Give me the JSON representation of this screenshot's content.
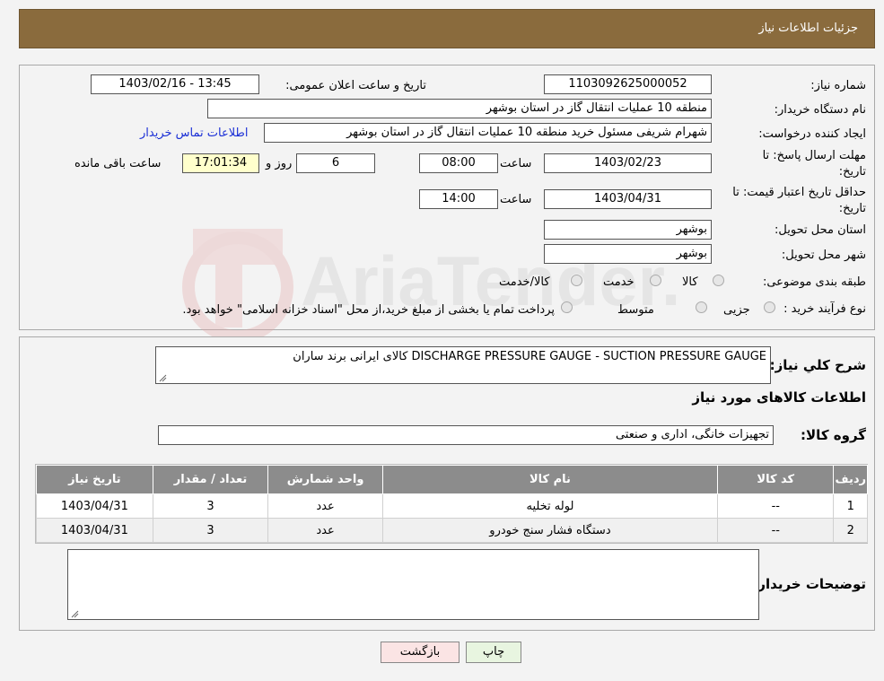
{
  "header": {
    "title": "جزئیات اطلاعات نیاز"
  },
  "form": {
    "need_number_label": "شماره نیاز:",
    "need_number": "1103092625000052",
    "announce_label": "تاریخ و ساعت اعلان عمومی:",
    "announce_value": "1403/02/16 - 13:45",
    "buyer_org_label": "نام دستگاه خریدار:",
    "buyer_org": "منطقه 10 عملیات انتقال گاز در استان بوشهر",
    "creator_label": "ایجاد کننده درخواست:",
    "creator": "شهرام شریفی مسئول خرید منطقه 10 عملیات انتقال گاز در استان بوشهر",
    "contact_link": "اطلاعات تماس خریدار",
    "deadline_label_1": "مهلت ارسال پاسخ: تا",
    "deadline_label_2": "تاریخ:",
    "deadline_date": "1403/02/23",
    "time_label": "ساعت",
    "deadline_time": "08:00",
    "days_value": "6",
    "days_label": "روز و",
    "remaining_time": "17:01:34",
    "remaining_label": "ساعت باقی مانده",
    "validity_label_1": "حداقل تاریخ اعتبار قیمت: تا",
    "validity_label_2": "تاریخ:",
    "validity_date": "1403/04/31",
    "validity_time": "14:00",
    "province_label": "استان محل تحویل:",
    "province": "بوشهر",
    "city_label": "شهر محل تحویل:",
    "city": "بوشهر",
    "category_label": "طبقه بندی موضوعی:",
    "category_options": [
      "کالا",
      "خدمت",
      "کالا/خدمت"
    ],
    "process_label": "نوع فرآیند خرید :",
    "process_options": [
      "جزیی",
      "متوسط"
    ],
    "process_note": "پرداخت تمام یا بخشی از مبلغ خرید،از محل \"اسناد خزانه اسلامی\" خواهد بود."
  },
  "watermark": {
    "text": "AriaTender.neT"
  },
  "details": {
    "summary_label": "شرح كلي نياز:",
    "summary": "DISCHARGE PRESSURE GAUGE - SUCTION PRESSURE GAUGE کالای ایرانی برند ساران",
    "items_title": "اطلاعات کالاهای مورد نیاز",
    "group_label": "گروه کالا:",
    "group": "تجهیزات خانگی، اداری و صنعتی",
    "table": {
      "headers": [
        "ردیف",
        "کد کالا",
        "نام کالا",
        "واحد شمارش",
        "تعداد / مقدار",
        "تاریخ نیاز"
      ],
      "rows": [
        [
          "1",
          "--",
          "لوله تخلیه",
          "عدد",
          "3",
          "1403/04/31"
        ],
        [
          "2",
          "--",
          "دستگاه فشار سنج خودرو",
          "عدد",
          "3",
          "1403/04/31"
        ]
      ]
    },
    "buyer_notes_label": "توضیحات خریدار:",
    "buyer_notes": ""
  },
  "buttons": {
    "print": "چاپ",
    "back": "بازگشت"
  }
}
